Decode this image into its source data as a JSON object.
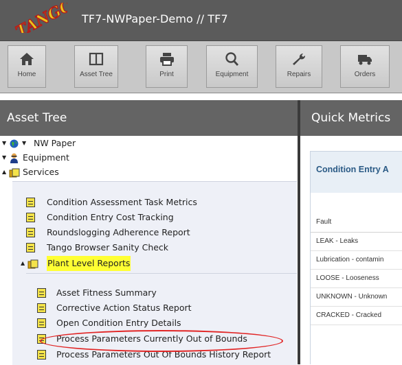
{
  "app": {
    "logo_text": "TANGO",
    "title": "TF7-NWPaper-Demo  // TF7"
  },
  "toolbar": {
    "buttons": [
      {
        "label": "Home",
        "icon": "home-icon"
      },
      {
        "label": "Asset Tree",
        "icon": "columns-icon"
      },
      {
        "label": "Print",
        "icon": "printer-icon"
      },
      {
        "label": "Equipment",
        "icon": "search-icon"
      },
      {
        "label": "Repairs",
        "icon": "wrench-icon"
      },
      {
        "label": "Orders",
        "icon": "truck-icon"
      }
    ]
  },
  "asset_tree": {
    "header": "Asset Tree",
    "root": "NW Paper",
    "equipment": "Equipment",
    "services": "Services",
    "service_items": [
      "Condition Assessment Task Metrics",
      "Condition Entry Cost Tracking",
      "Roundslogging Adherence Report",
      "Tango Browser Sanity Check"
    ],
    "plant_level": "Plant Level Reports",
    "plant_items": [
      "Asset Fitness Summary",
      "Corrective Action Status Report",
      "Open Condition Entry Details",
      "Process Parameters Currently Out of Bounds",
      "Process Parameters Out Of Bounds History Report"
    ]
  },
  "quick_metrics": {
    "header": "Quick Metrics",
    "card_title": "Condition Entry A",
    "column_header": "Fault",
    "rows": [
      "LEAK - Leaks",
      "Lubrication - contamin",
      "LOOSE - Looseness",
      "UNKNOWN - Unknown",
      "CRACKED - Cracked"
    ]
  },
  "colors": {
    "titlebar": "#5b5b5b",
    "toolbar": "#c8c8c8",
    "panel_header": "#646464",
    "highlight": "#ffff33",
    "annotation_ellipse": "#e12525",
    "card_title": "#2a5a85"
  }
}
